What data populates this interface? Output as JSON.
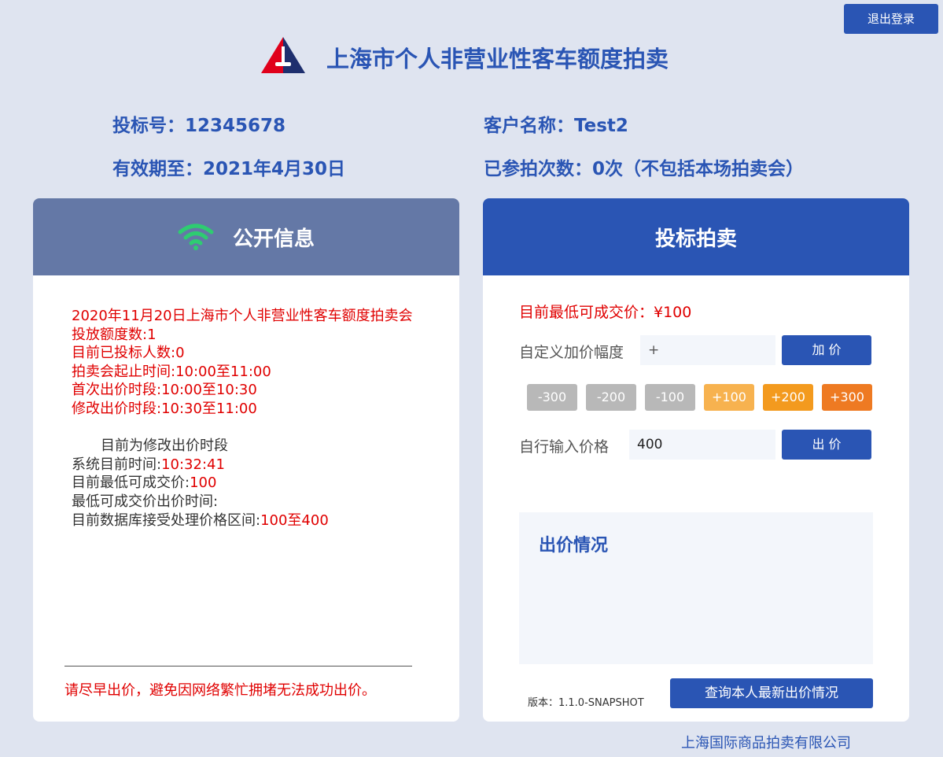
{
  "header": {
    "logout_label": "退出登录",
    "title": "上海市个人非营业性客车额度拍卖"
  },
  "user": {
    "bid_number": "投标号：12345678",
    "customer_name": "客户名称：Test2",
    "valid_until": "有效期至：2021年4月30日",
    "participation": "已参拍次数：0次（不包括本场拍卖会）"
  },
  "public_info": {
    "title": "公开信息",
    "auction_name": "2020年11月20日上海市个人非营业性客车额度拍卖会",
    "quota": "投放额度数:1",
    "bidders": "目前已投标人数:0",
    "auction_time": "拍卖会起止时间:10:00至11:00",
    "first_bid_period": "首次出价时段:10:00至10:30",
    "modify_bid_period": "修改出价时段:10:30至11:00",
    "current_phase": "目前为修改出价时段",
    "system_time_label": "系统目前时间:",
    "system_time_value": "10:32:41",
    "min_price_label": "目前最低可成交价:",
    "min_price_value": "100",
    "min_price_time_label": "最低可成交价出价时间:",
    "price_range_label": "目前数据库接受处理价格区间:",
    "price_range_value": "100至400",
    "warning": "请尽早出价，避免因网络繁忙拥堵无法成功出价。"
  },
  "bidding": {
    "title": "投标拍卖",
    "min_price": "目前最低可成交价：¥100",
    "increment_label": "自定义加价幅度",
    "increment_value": "+",
    "add_button": "加 价",
    "steps": [
      "-300",
      "-200",
      "-100",
      "+100",
      "+200",
      "+300"
    ],
    "self_input_label": "自行输入价格",
    "self_input_value": "400",
    "bid_button": "出 价",
    "status_title": "出价情况",
    "version": "版本：1.1.0-SNAPSHOT",
    "query_button": "查询本人最新出价情况"
  },
  "footer": {
    "company": "上海国际商品拍卖有限公司"
  },
  "colors": {
    "brand_blue": "#2a55b4",
    "panel_gray_blue": "#6478a6",
    "alert_red": "#e00000",
    "background": "#dfe4f0"
  }
}
